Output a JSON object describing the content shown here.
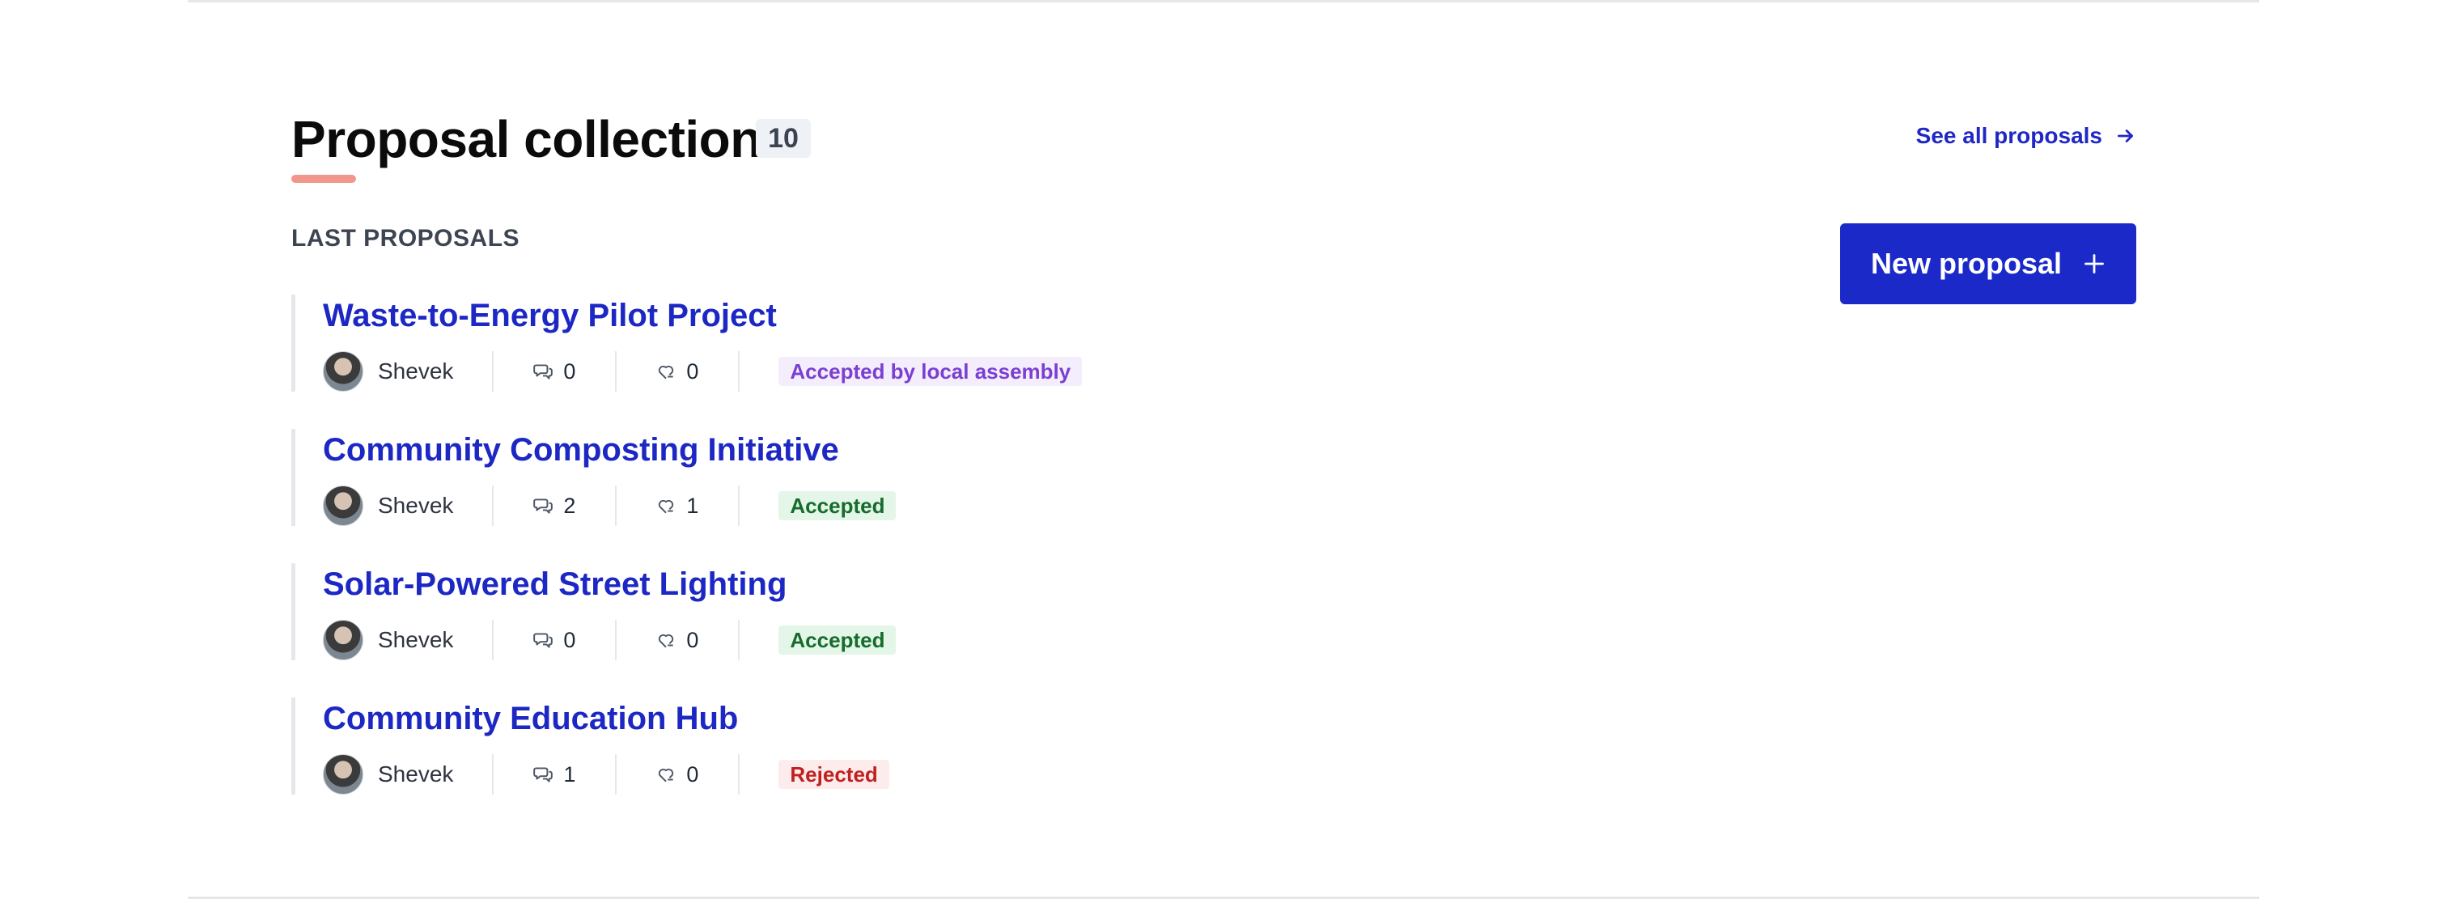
{
  "section": {
    "title": "Proposal collection",
    "count": "10",
    "see_all_label": "See all proposals",
    "subhead": "LAST PROPOSALS",
    "new_proposal_label": "New proposal"
  },
  "proposals": [
    {
      "title": "Waste-to-Energy Pilot Project",
      "author": "Shevek",
      "comments": "0",
      "endorsements": "0",
      "status": "Accepted by local assembly",
      "status_color": "#7b3fd1"
    },
    {
      "title": "Community Composting Initiative",
      "author": "Shevek",
      "comments": "2",
      "endorsements": "1",
      "status": "Accepted",
      "status_color": "#176b2c"
    },
    {
      "title": "Solar-Powered Street Lighting",
      "author": "Shevek",
      "comments": "0",
      "endorsements": "0",
      "status": "Accepted",
      "status_color": "#176b2c"
    },
    {
      "title": "Community Education Hub",
      "author": "Shevek",
      "comments": "1",
      "endorsements": "0",
      "status": "Rejected",
      "status_color": "#c21f1f"
    }
  ],
  "colors": {
    "accent": "#1b29c9",
    "title_underline": "#f2958d"
  },
  "icons": {
    "see_all": "arrow-right-icon",
    "new_proposal": "plus-icon",
    "comments": "comments-icon",
    "endorsements": "endorsement-icon"
  }
}
